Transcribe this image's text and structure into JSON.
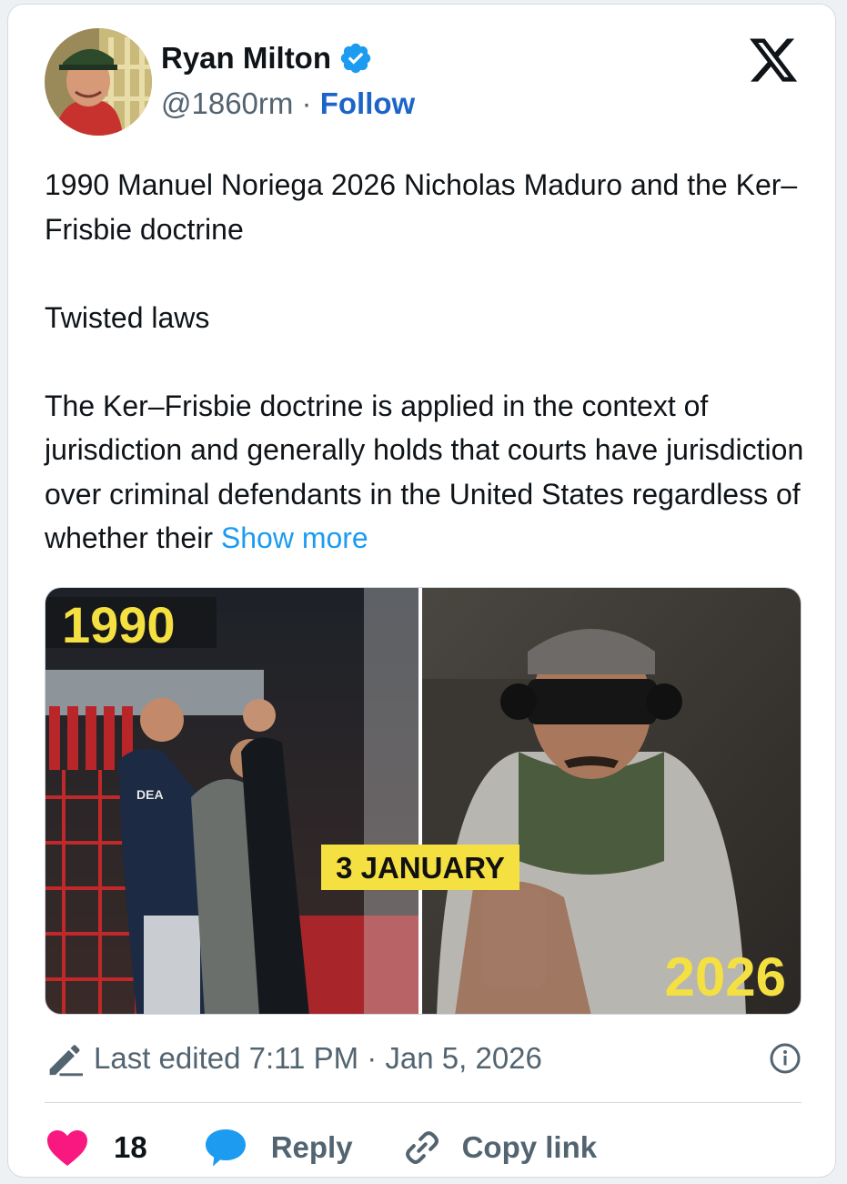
{
  "colors": {
    "link": "#1d9bf0",
    "follow": "#1d64c8",
    "heart": "#f91880",
    "verified": "#1d9bf0",
    "secondary_text": "#536471",
    "primary_text": "#0f1419"
  },
  "author": {
    "name": "Ryan Milton",
    "handle": "@1860rm",
    "separator": " · ",
    "follow_label": "Follow",
    "verified_icon": "verified-badge-icon",
    "avatar": "avatar"
  },
  "platform_icon": "x-logo-icon",
  "tweet": {
    "line1": "1990 Manuel Noriega 2026 Nicholas Maduro and the  Ker–Frisbie doctrine",
    "line2": "Twisted laws",
    "line3": "The Ker–Frisbie doctrine is applied in the context of jurisdiction and generally holds that courts have jurisdiction over criminal defendants in the United States regardless of whether their",
    "show_more": "Show more"
  },
  "media": {
    "label_left": "1990",
    "label_center": "3 JANUARY",
    "label_right": "2026",
    "vest_text": "DEA"
  },
  "meta": {
    "edited": "Last edited 7:11 PM · Jan 5, 2026",
    "edit_icon": "pencil-icon",
    "info_icon": "info-icon"
  },
  "actions": {
    "like_count": "18",
    "reply_label": "Reply",
    "copy_label": "Copy link"
  }
}
